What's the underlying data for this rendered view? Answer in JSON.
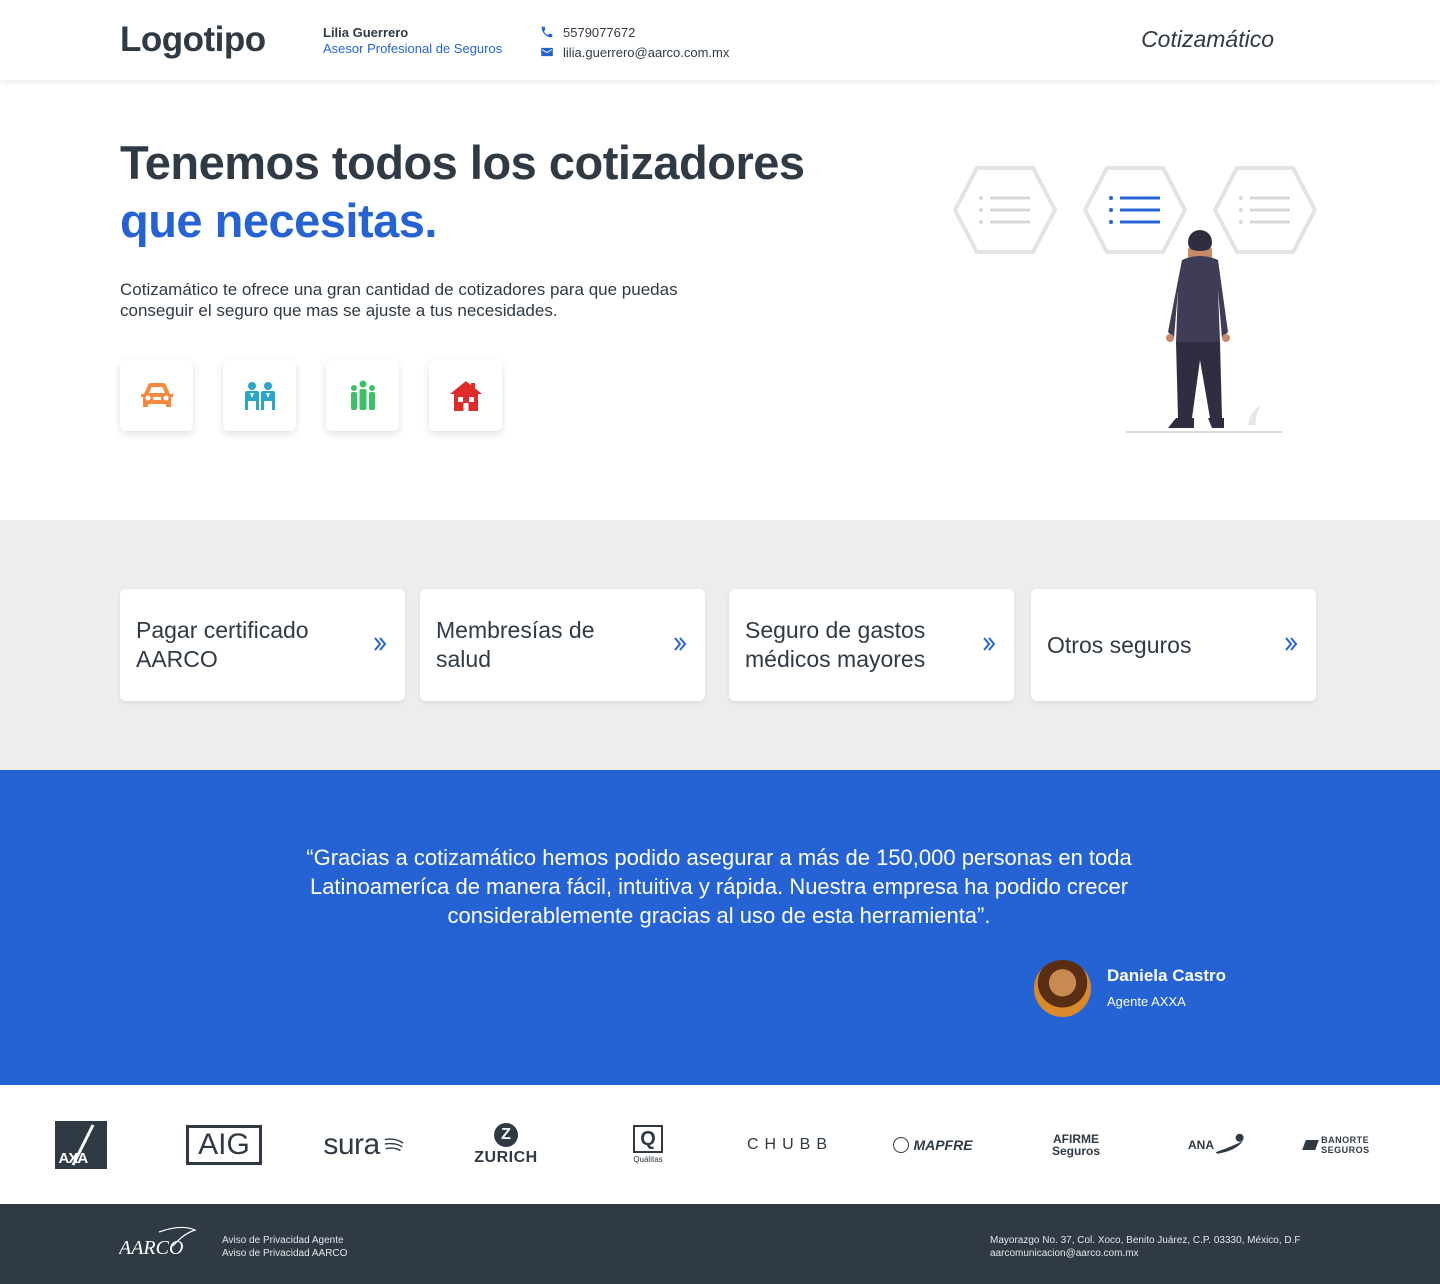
{
  "header": {
    "logo": "Logotipo",
    "agent_name": "Lilia Guerrero",
    "agent_role": "Asesor Profesional de Seguros",
    "phone": "5579077672",
    "email": "lilia.guerrero@aarco.com.mx",
    "brand": "Cotizamático"
  },
  "hero": {
    "title_line1": "Tenemos todos los cotizadores",
    "title_line2": "que necesitas.",
    "description": "Cotizamático te ofrece una gran cantidad de cotizadores para que puedas conseguir el seguro que mas se ajuste a tus necesidades.",
    "tiles": [
      {
        "icon": "car-icon",
        "color": "#f5893d"
      },
      {
        "icon": "couple-icon",
        "color": "#2aa6c9"
      },
      {
        "icon": "family-icon",
        "color": "#3cc068"
      },
      {
        "icon": "house-icon",
        "color": "#e02b2b"
      }
    ]
  },
  "cards": [
    {
      "label": "Pagar certificado AARCO"
    },
    {
      "label": "Membresías de salud"
    },
    {
      "label": "Seguro de gastos médicos mayores"
    },
    {
      "label": "Otros seguros"
    }
  ],
  "testimonial": {
    "quote": "“Gracias a cotizamático hemos podido asegurar a más de 150,000 personas en toda Latinoameríca de manera fácil, intuitiva y rápida. Nuestra empresa ha podido crecer considerablemente gracias al uso de esta herramienta”.",
    "name": "Daniela Castro",
    "role": "Agente AXXA"
  },
  "insurers": [
    "AXA",
    "AIG",
    "sura",
    "ZURICH",
    "Quálitas",
    "CHUBB",
    "MAPFRE",
    "AFIRME Seguros",
    "ANA",
    "BANORTE SEGUROS"
  ],
  "footer": {
    "logo": "AARCO",
    "link_agent": "Aviso de Privacidad Agente",
    "link_aarco": "Aviso de Privacidad AARCO",
    "address": "Mayorazgo No. 37, Col. Xoco, Benito Juárez, C.P. 03330,  México, D.F",
    "contact_email": "aarcomunicacion@aarco.com.mx"
  },
  "colors": {
    "accent": "#2563d4",
    "dark": "#2f3a45",
    "gray_bg": "#ecedef"
  }
}
